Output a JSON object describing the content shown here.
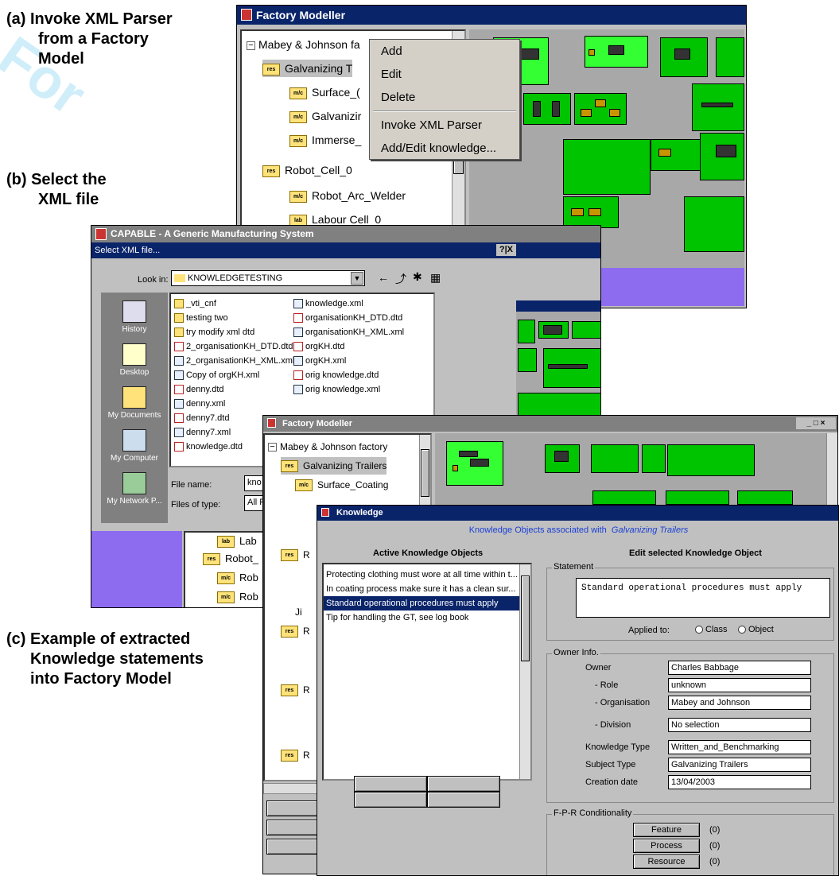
{
  "captions": {
    "a": [
      "(a) Invoke XML Parser",
      "from a Factory",
      "Model"
    ],
    "b": [
      "(b) Select the",
      "XML file"
    ],
    "c": [
      "(c) Example of extracted",
      "Knowledge statements",
      "into Factory Model"
    ]
  },
  "watermark": "For",
  "win1": {
    "title": "Factory Modeller",
    "tree": [
      {
        "label": "Mabey & Johnson fa",
        "icon": ""
      },
      {
        "label": "Galvanizing T",
        "icon": "res"
      },
      {
        "label": "Surface_(",
        "icon": "m/c"
      },
      {
        "label": "Galvanizir",
        "icon": "m/c"
      },
      {
        "label": "Immerse_",
        "icon": "m/c"
      },
      {
        "label": "Robot_Cell_0",
        "icon": "res"
      },
      {
        "label": "Robot_Arc_Welder",
        "icon": "m/c"
      },
      {
        "label": "Labour Cell_0",
        "icon": "lab"
      }
    ],
    "menu": [
      "Add",
      "Edit",
      "Delete",
      "Invoke XML Parser",
      "Add/Edit knowledge..."
    ]
  },
  "win2": {
    "title": "CAPABLE - A Generic Manufacturing System",
    "dialog_title": "Select XML file...",
    "dialog_buttons": "?|X",
    "look_in_label": "Look in:",
    "look_in_value": "KNOWLEDGETESTING",
    "places": [
      "History",
      "Desktop",
      "My Documents",
      "My Computer",
      "My Network P..."
    ],
    "files_col1": [
      {
        "name": "_vti_cnf",
        "type": "folder"
      },
      {
        "name": "testing two",
        "type": "folder"
      },
      {
        "name": "try modify xml dtd",
        "type": "folder"
      },
      {
        "name": "2_organisationKH_DTD.dtd",
        "type": "dtd"
      },
      {
        "name": "2_organisationKH_XML.xml",
        "type": "xml"
      },
      {
        "name": "Copy of orgKH.xml",
        "type": "xml"
      },
      {
        "name": "denny.dtd",
        "type": "dtd"
      },
      {
        "name": "denny.xml",
        "type": "xml"
      },
      {
        "name": "denny7.dtd",
        "type": "dtd"
      },
      {
        "name": "denny7.xml",
        "type": "xml"
      },
      {
        "name": "knowledge.dtd",
        "type": "dtd"
      }
    ],
    "files_col2": [
      {
        "name": "knowledge.xml",
        "type": "xml"
      },
      {
        "name": "organisationKH_DTD.dtd",
        "type": "dtd"
      },
      {
        "name": "organisationKH_XML.xml",
        "type": "xml"
      },
      {
        "name": "orgKH.dtd",
        "type": "dtd"
      },
      {
        "name": "orgKH.xml",
        "type": "xml"
      },
      {
        "name": "orig knowledge.dtd",
        "type": "dtd"
      },
      {
        "name": "orig knowledge.xml",
        "type": "xml"
      }
    ],
    "file_name_label": "File name:",
    "file_name_value": "kno",
    "files_of_type_label": "Files of type:",
    "files_of_type_value": "All F",
    "tree_fragments": [
      "Lab",
      "Robot_",
      "Rob",
      "Rob"
    ]
  },
  "win3": {
    "title": "Factory Modeller",
    "tree": [
      {
        "label": "Mabey & Johnson factory",
        "icon": ""
      },
      {
        "label": "Galvanizing Trailers",
        "icon": "res"
      },
      {
        "label": "Surface_Coating",
        "icon": "m/c"
      },
      {
        "label": "R",
        "icon": "res"
      },
      {
        "label": "Ji",
        "icon": ""
      },
      {
        "label": "R",
        "icon": "res"
      },
      {
        "label": "R",
        "icon": "res"
      },
      {
        "label": "R",
        "icon": "res"
      }
    ]
  },
  "knowledge": {
    "title": "Knowledge",
    "header_prefix": "Knowledge Objects associated with",
    "header_subject": "Galvanizing Trailers",
    "active_heading": "Active Knowledge Objects",
    "edit_heading": "Edit selected Knowledge Object",
    "items": [
      "Protecting clothing must wore at all time within t...",
      "In coating process make sure it has a clean sur...",
      "Standard operational procedures must apply",
      "Tip for handling the GT, see log book"
    ],
    "selected_index": 2,
    "statement_label": "Statement",
    "statement_text": "Standard operational procedures must apply",
    "applied_to_label": "Applied to:",
    "applied_options": [
      "Class",
      "Object"
    ],
    "owner_group_label": "Owner Info.",
    "owner_fields": [
      {
        "label": "Owner",
        "value": "Charles Babbage"
      },
      {
        "label": "- Role",
        "value": "unknown"
      },
      {
        "label": "- Organisation",
        "value": "Mabey and Johnson"
      },
      {
        "label": "- Division",
        "value": "No selection"
      },
      {
        "label": "Knowledge Type",
        "value": "Written_and_Benchmarking"
      },
      {
        "label": "Subject Type",
        "value": "Galvanizing Trailers"
      },
      {
        "label": "Creation date",
        "value": "13/04/2003"
      }
    ],
    "fpr_label": "F-P-R Conditionality",
    "fpr_buttons": [
      {
        "label": "Feature",
        "count": "(0)"
      },
      {
        "label": "Process",
        "count": "(0)"
      },
      {
        "label": "Resource",
        "count": "(0)"
      }
    ]
  }
}
